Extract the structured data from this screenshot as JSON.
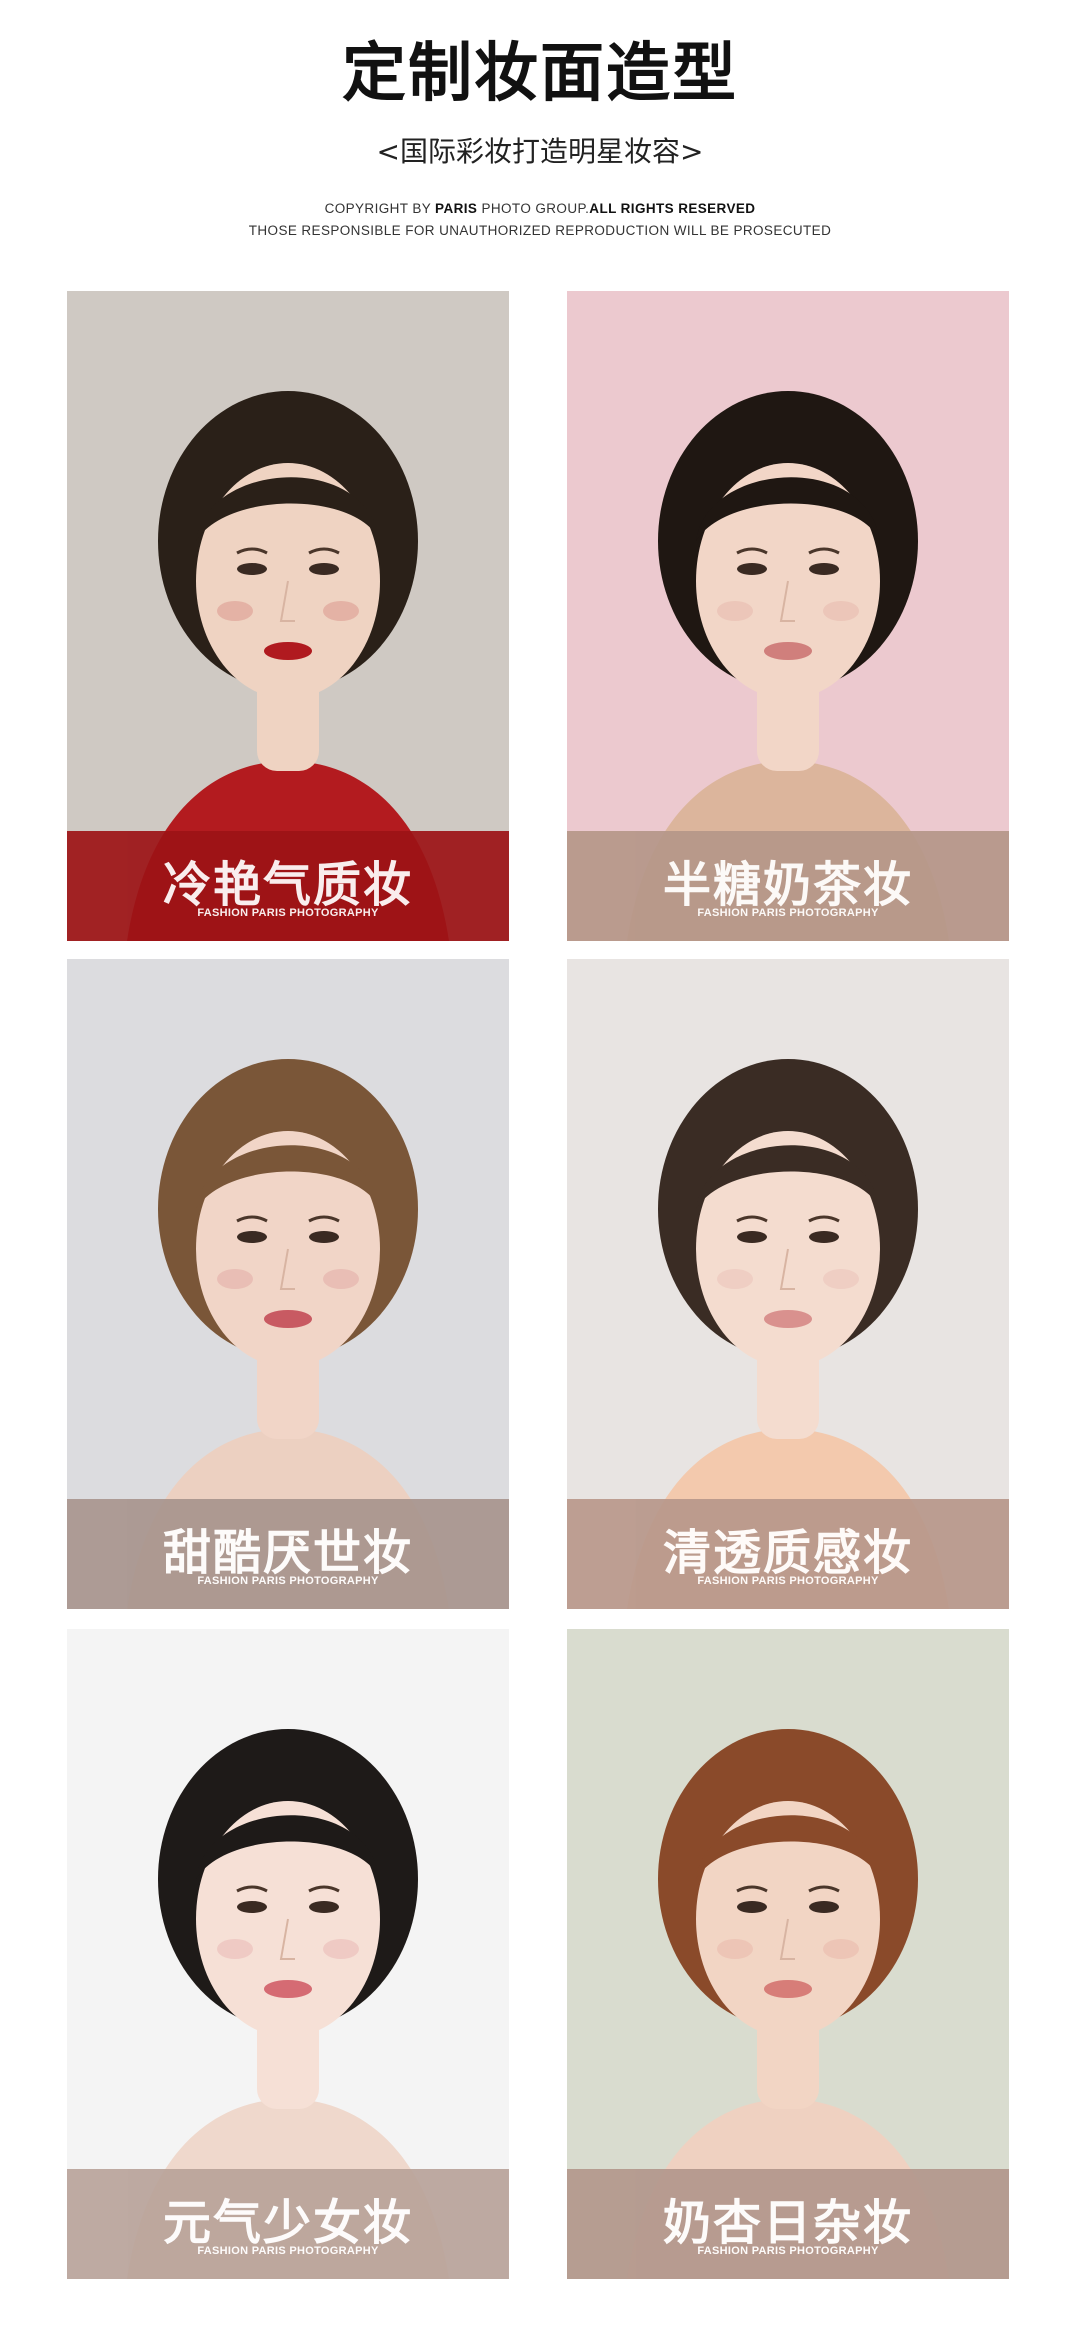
{
  "header": {
    "title": "定制妆面造型",
    "subtitle": "<国际彩妆打造明星妆容>",
    "copyright_prefix": "COPYRIGHT BY ",
    "copyright_brand": "PARIS",
    "copyright_middle": "  PHOTO GROUP.",
    "copyright_bold": "ALL RIGHTS RESERVED",
    "copyright_line2": "THOSE RESPONSIBLE FOR UNAUTHORIZED REPRODUCTION WILL BE PROSECUTED"
  },
  "cards": [
    {
      "title": "冷艳气质妆",
      "subtitle": "FASHION PARIS PHOTOGRAPHY",
      "bg": "#cfc9c3",
      "band": "#9d1316",
      "hair": "#2a2018",
      "cloth": "#b31b1f",
      "skin": "#efd3c2",
      "lip": "#b01a1f"
    },
    {
      "title": "半糖奶茶妆",
      "subtitle": "FASHION PARIS PHOTOGRAPHY",
      "bg": "#ecc9cf",
      "band": "#b59789",
      "hair": "#1f1712",
      "cloth": "#dcb59c",
      "skin": "#f2d6c7",
      "lip": "#d07f7c"
    },
    {
      "title": "甜酷厌世妆",
      "subtitle": "FASHION PARIS PHOTOGRAPHY",
      "bg": "#dcdcdf",
      "band": "#a8958e",
      "hair": "#7a5638",
      "cloth": "#ecd0c1",
      "skin": "#f1d5c7",
      "lip": "#c85a62"
    },
    {
      "title": "清透质感妆",
      "subtitle": "FASHION PARIS PHOTOGRAPHY",
      "bg": "#e8e4e2",
      "band": "#b8988b",
      "hair": "#3a2c24",
      "cloth": "#f3c9ad",
      "skin": "#f4dccf",
      "lip": "#d9918e"
    },
    {
      "title": "元气少女妆",
      "subtitle": "FASHION PARIS PHOTOGRAPHY",
      "bg": "#f4f4f4",
      "band": "#b9a39a",
      "hair": "#1e1a18",
      "cloth": "#efd8cc",
      "skin": "#f6e0d6",
      "lip": "#d56b73"
    },
    {
      "title": "奶杏日杂妆",
      "subtitle": "FASHION PARIS PHOTOGRAPHY",
      "bg": "#d9dccf",
      "band": "#b3978c",
      "hair": "#8a4a2a",
      "cloth": "#efd1c1",
      "skin": "#f2d5c4",
      "lip": "#d77d78"
    }
  ]
}
